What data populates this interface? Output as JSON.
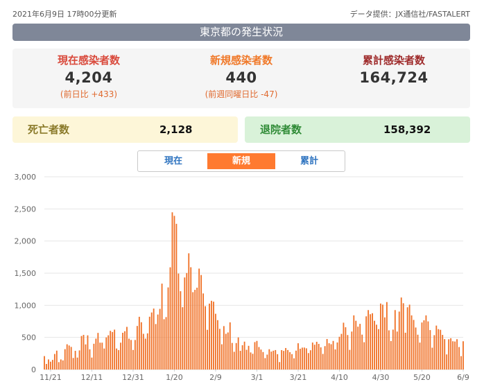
{
  "header": {
    "updated": "2021年6月9日 17時00分更新",
    "source": "データ提供：JX通信社/FASTALERT",
    "title": "東京都の発生状況"
  },
  "stats": {
    "current": {
      "label": "現在感染者数",
      "value": "4,204",
      "sub": "(前日比 +433)"
    },
    "new": {
      "label": "新規感染者数",
      "value": "440",
      "sub": "(前週同曜日比 -47)"
    },
    "total": {
      "label": "累計感染者数",
      "value": "164,724"
    }
  },
  "deaths": {
    "label": "死亡者数",
    "value": "2,128"
  },
  "recovered": {
    "label": "退院者数",
    "value": "158,392"
  },
  "tabs": [
    {
      "label": "現在",
      "active": false
    },
    {
      "label": "新規",
      "active": true
    },
    {
      "label": "累計",
      "active": false
    }
  ],
  "colors": {
    "bar": "#f07228",
    "grid": "#e6e6e6",
    "tab_active": "#ff7a30"
  },
  "chart_data": {
    "type": "bar",
    "start_date": "2020-11-01",
    "end_date": "2021-06-09",
    "ylim": [
      0,
      3000
    ],
    "yticks": [
      0,
      500,
      1000,
      1500,
      2000,
      2500,
      3000
    ],
    "ytick_labels": [
      "0",
      "500",
      "1,000",
      "1,500",
      "2,000",
      "2,500",
      "3,000"
    ],
    "xtick_labels": [
      "11/21",
      "12/11",
      "12/31",
      "1/20",
      "2/9",
      "3/1",
      "3/21",
      "4/10",
      "4/30",
      "5/20",
      "6/9"
    ],
    "values": [
      209,
      87,
      157,
      122,
      150,
      242,
      294,
      115,
      157,
      142,
      317,
      393,
      374,
      352,
      180,
      291,
      186,
      298,
      522,
      539,
      391,
      532,
      314,
      186,
      401,
      481,
      570,
      418,
      418,
      327,
      500,
      533,
      602,
      584,
      621,
      327,
      302,
      418,
      572,
      596,
      664,
      480,
      460,
      305,
      460,
      678,
      821,
      736,
      556,
      481,
      563,
      822,
      888,
      949,
      708,
      856,
      944,
      1337,
      783,
      816,
      1278,
      1591,
      2447,
      2392,
      2268,
      1494,
      1219,
      970,
      1433,
      1502,
      1809,
      1592,
      1204,
      1240,
      1274,
      1571,
      1471,
      1184,
      986,
      618,
      1026,
      1070,
      1056,
      868,
      769,
      633,
      393,
      676,
      556,
      577,
      734,
      414,
      276,
      412,
      500,
      291,
      378,
      434,
      307,
      369,
      266,
      245,
      427,
      445,
      350,
      311,
      272,
      178,
      232,
      316,
      279,
      293,
      303,
      239,
      116,
      302,
      290,
      335,
      304,
      270,
      240,
      175,
      294,
      409,
      323,
      341,
      342,
      330,
      256,
      300,
      420,
      386,
      432,
      399,
      345,
      243,
      364,
      475,
      409,
      394,
      445,
      313,
      421,
      510,
      555,
      729,
      658,
      537,
      306,
      591,
      843,
      759,
      667,
      711,
      543,
      425,
      828,
      925,
      861,
      876,
      759,
      698,
      629,
      1027,
      1010,
      812,
      1050,
      610,
      444,
      621,
      925,
      591,
      902,
      1121,
      1032,
      573,
      969,
      1010,
      843,
      772,
      654,
      542,
      419,
      732,
      766,
      843,
      749,
      614,
      340,
      535,
      684,
      629,
      618,
      539,
      473,
      235,
      471,
      487,
      440,
      436,
      472,
      350,
      209,
      440
    ]
  }
}
